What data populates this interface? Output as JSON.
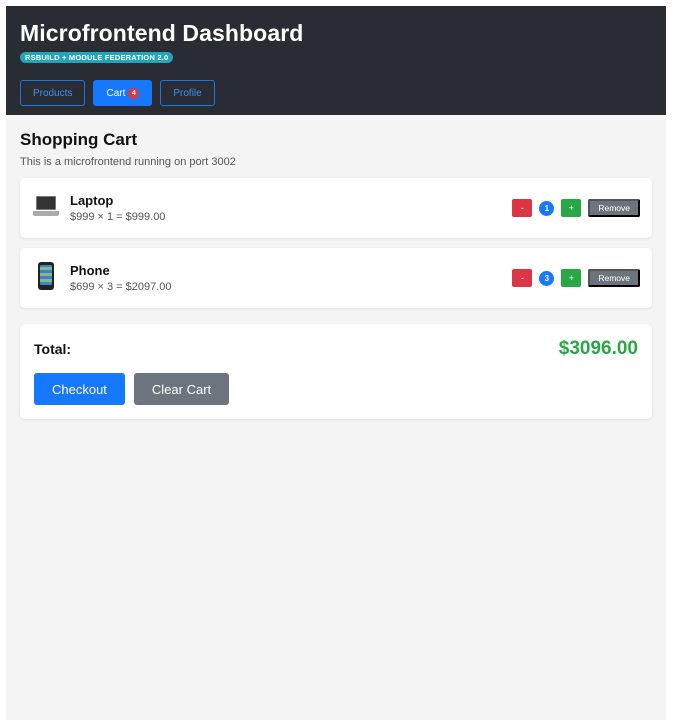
{
  "header": {
    "title": "Microfrontend Dashboard",
    "tech_badge": "RSBUILD + MODULE FEDERATION 2.0",
    "nav": [
      {
        "label": "Products",
        "active": false
      },
      {
        "label": "Cart",
        "active": true,
        "count": "4"
      },
      {
        "label": "Profile",
        "active": false
      }
    ]
  },
  "main": {
    "title": "Shopping Cart",
    "subtitle": "This is a microfrontend running on port 3002"
  },
  "cart": {
    "items": [
      {
        "icon": "laptop-icon",
        "name": "Laptop",
        "price_line": "$999 × 1 = $999.00",
        "qty": "1",
        "minus": "-",
        "plus": "+",
        "remove": "Remove"
      },
      {
        "icon": "phone-icon",
        "name": "Phone",
        "price_line": "$699 × 3 = $2097.00",
        "qty": "3",
        "minus": "-",
        "plus": "+",
        "remove": "Remove"
      }
    ],
    "total_label": "Total:",
    "total_value": "$3096.00",
    "checkout_label": "Checkout",
    "clear_label": "Clear Cart"
  },
  "colors": {
    "header_bg": "#2a2c33",
    "accent": "#1677ff",
    "danger": "#dc3545",
    "success": "#28a745",
    "secondary": "#6c757d",
    "tech_badge": "#22a5b6"
  }
}
